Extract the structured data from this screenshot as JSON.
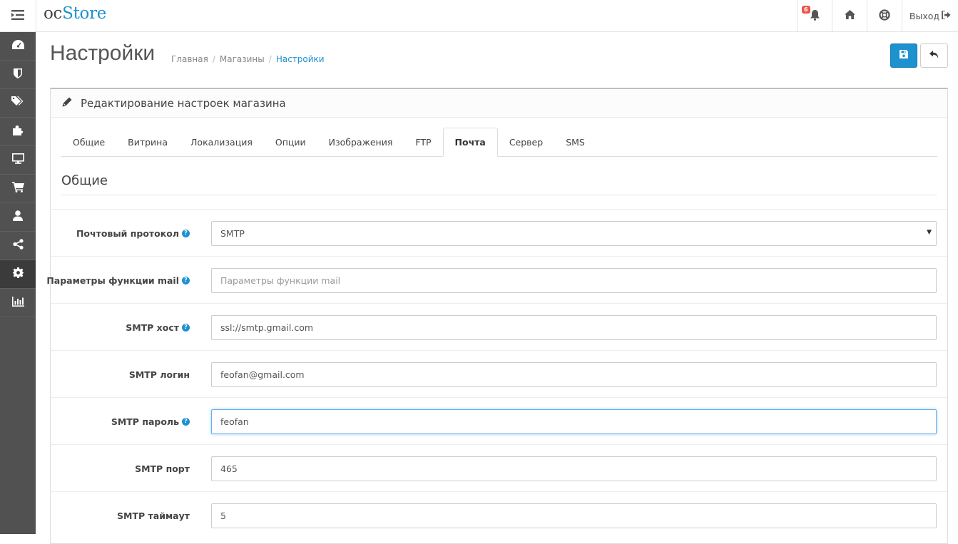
{
  "header": {
    "logo_oc": "oc",
    "logo_store": "Store",
    "notification_count": "6",
    "logout_label": "Выход"
  },
  "sidebar": {
    "items": [
      {
        "icon": "dashboard-icon"
      },
      {
        "icon": "catalog-icon"
      },
      {
        "icon": "tags-icon"
      },
      {
        "icon": "extensions-icon"
      },
      {
        "icon": "design-icon"
      },
      {
        "icon": "cart-icon"
      },
      {
        "icon": "customers-icon"
      },
      {
        "icon": "marketing-icon"
      },
      {
        "icon": "settings-icon",
        "active": true
      },
      {
        "icon": "reports-icon"
      }
    ]
  },
  "page": {
    "title": "Настройки",
    "breadcrumb": [
      "Главная",
      "Магазины",
      "Настройки"
    ]
  },
  "panel": {
    "title": "Редактирование настроек магазина",
    "tabs": [
      "Общие",
      "Витрина",
      "Локализация",
      "Опции",
      "Изображения",
      "FTP",
      "Почта",
      "Сервер",
      "SMS"
    ],
    "active_tab": "Почта",
    "legend": "Общие",
    "fields": [
      {
        "label": "Почтовый протокол",
        "help": true,
        "type": "select",
        "value": "SMTP"
      },
      {
        "label": "Параметры функции mail",
        "help": true,
        "type": "input",
        "value": "",
        "placeholder": "Параметры функции mail"
      },
      {
        "label": "SMTP хост",
        "help": true,
        "type": "input",
        "value": "ssl://smtp.gmail.com"
      },
      {
        "label": "SMTP логин",
        "help": false,
        "type": "input",
        "value": "feofan@gmail.com"
      },
      {
        "label": "SMTP пароль",
        "help": true,
        "type": "input",
        "value": "feofan",
        "focused": true
      },
      {
        "label": "SMTP порт",
        "help": false,
        "type": "input",
        "value": "465"
      },
      {
        "label": "SMTP таймаут",
        "help": false,
        "type": "input",
        "value": "5"
      }
    ]
  },
  "colors": {
    "primary": "#1e91cf",
    "sidebar_bg": "#515151",
    "sidebar_active": "#3b3b3b",
    "badge": "#e8574e"
  }
}
